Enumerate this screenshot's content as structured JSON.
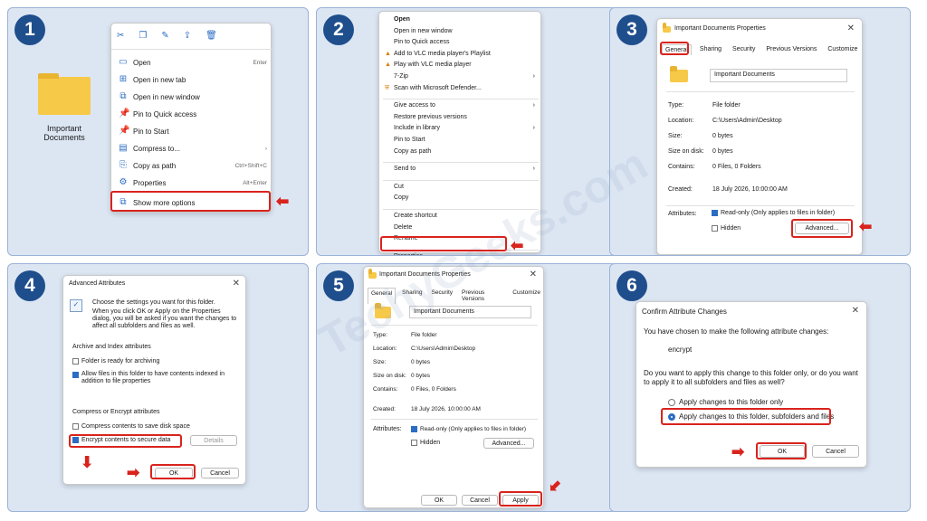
{
  "steps": [
    "1",
    "2",
    "3",
    "4",
    "5",
    "6"
  ],
  "watermark": "TechyGeeks.com",
  "panel1": {
    "folder_label_line1": "Important",
    "folder_label_line2": "Documents",
    "toolbar_icons": [
      "cut-icon",
      "copy-icon",
      "rename-icon",
      "share-icon",
      "delete-icon"
    ],
    "menu": [
      {
        "label": "Open",
        "shortcut": "Enter",
        "icon": "folder-icon"
      },
      {
        "label": "Open in new tab",
        "shortcut": "",
        "icon": "new-tab-icon"
      },
      {
        "label": "Open in new window",
        "shortcut": "",
        "icon": "new-window-icon"
      },
      {
        "label": "Pin to Quick access",
        "shortcut": "",
        "icon": "pin-icon"
      },
      {
        "label": "Pin to Start",
        "shortcut": "",
        "icon": "pin-icon"
      },
      {
        "label": "Compress to...",
        "shortcut": "›",
        "icon": "zip-icon"
      },
      {
        "label": "Copy as path",
        "shortcut": "Ctrl+Shift+C",
        "icon": "path-icon"
      },
      {
        "label": "Properties",
        "shortcut": "Alt+Enter",
        "icon": "properties-icon"
      }
    ],
    "more_options": "Show more options"
  },
  "panel2": {
    "items": [
      {
        "label": "Open",
        "bold": true
      },
      {
        "label": "Open in new window"
      },
      {
        "label": "Pin to Quick access"
      },
      {
        "label": "Add to VLC media player's Playlist",
        "icon": "vlc-icon"
      },
      {
        "label": "Play with VLC media player",
        "icon": "vlc-icon"
      },
      {
        "label": "7-Zip",
        "arrow": "›"
      },
      {
        "label": "Scan with Microsoft Defender...",
        "icon": "defender-icon"
      },
      {
        "sep": true
      },
      {
        "label": "Give access to",
        "arrow": "›"
      },
      {
        "label": "Restore previous versions"
      },
      {
        "label": "Include in library",
        "arrow": "›"
      },
      {
        "label": "Pin to Start"
      },
      {
        "label": "Copy as path"
      },
      {
        "sep": true
      },
      {
        "label": "Send to",
        "arrow": "›"
      },
      {
        "sep": true
      },
      {
        "label": "Cut"
      },
      {
        "label": "Copy"
      },
      {
        "sep": true
      },
      {
        "label": "Create shortcut"
      },
      {
        "label": "Delete"
      },
      {
        "label": "Rename"
      },
      {
        "sep": true
      },
      {
        "label": "Properties"
      }
    ]
  },
  "props": {
    "title": "Important Documents Properties",
    "tabs": [
      "General",
      "Sharing",
      "Security",
      "Previous Versions",
      "Customize"
    ],
    "name": "Important Documents",
    "fields": [
      {
        "label": "Type:",
        "value": "File folder"
      },
      {
        "label": "Location:",
        "value": "C:\\Users\\Admin\\Desktop"
      },
      {
        "label": "Size:",
        "value": "0 bytes"
      },
      {
        "label": "Size on disk:",
        "value": "0 bytes"
      },
      {
        "label": "Contains:",
        "value": "0 Files, 0 Folders"
      },
      {
        "label": "Created:",
        "value": "18 July 2026, 10:00:00 AM"
      }
    ],
    "attributes_label": "Attributes:",
    "readonly_label": "Read-only (Only applies to files in folder)",
    "hidden_label": "Hidden",
    "advanced_label": "Advanced...",
    "ok": "OK",
    "cancel": "Cancel",
    "apply": "Apply"
  },
  "panel4": {
    "title": "Advanced Attributes",
    "intro1": "Choose the settings you want for this folder.",
    "intro2": "When you click OK or Apply on the Properties dialog, you will be asked if you want the changes to affect all subfolders and files as well.",
    "archive_heading": "Archive and Index attributes",
    "archive_opt": "Folder is ready for archiving",
    "index_opt": "Allow files in this folder to have contents indexed in addition to file properties",
    "compress_heading": "Compress or Encrypt attributes",
    "compress_opt": "Compress contents to save disk space",
    "encrypt_opt": "Encrypt contents to secure data",
    "details": "Details",
    "ok": "OK",
    "cancel": "Cancel"
  },
  "panel6": {
    "title": "Confirm Attribute Changes",
    "line1": "You have chosen to make the following attribute changes:",
    "change": "encrypt",
    "question": "Do you want to apply this change to this folder only, or do you want to apply it to all subfolders and files as well?",
    "opt1": "Apply changes to this folder only",
    "opt2": "Apply changes to this folder, subfolders and files",
    "ok": "OK",
    "cancel": "Cancel"
  }
}
